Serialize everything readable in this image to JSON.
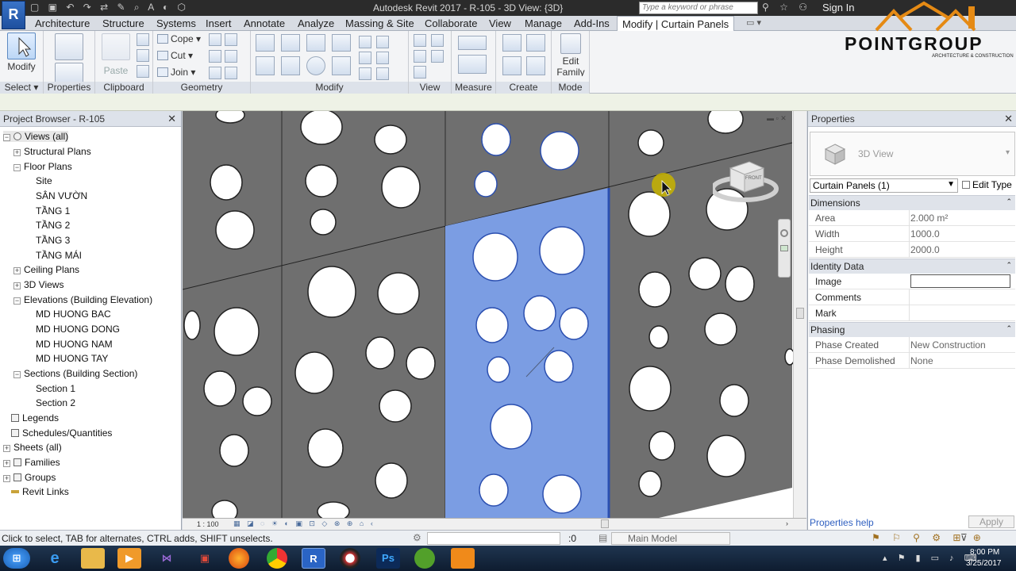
{
  "titlebar": {
    "app_title": "Autodesk Revit 2017  -   R-105 - 3D View: {3D}",
    "search_placeholder": "Type a keyword or phrase",
    "sign_in": "Sign In"
  },
  "tabs": [
    "Architecture",
    "Structure",
    "Systems",
    "Insert",
    "Annotate",
    "Analyze",
    "Massing & Site",
    "Collaborate",
    "View",
    "Manage",
    "Add-Ins",
    "Modify | Curtain Panels"
  ],
  "ribbon": {
    "modify_label": "Modify",
    "paste_label": "Paste",
    "cope_label": "Cope",
    "cut_label": "Cut",
    "join_label": "Join",
    "edit_family_label": "Edit Family",
    "panels": [
      "Select",
      "Properties",
      "Clipboard",
      "Geometry",
      "Modify",
      "View",
      "Measure",
      "Create",
      "Mode"
    ]
  },
  "logo": {
    "name": "POINTGROUP",
    "tagline": "ARCHITECTURE & CONSTRUCTION"
  },
  "project_browser": {
    "title": "Project Browser - R-105",
    "items": [
      {
        "label": "Views (all)"
      },
      {
        "label": "Structural Plans"
      },
      {
        "label": "Floor Plans"
      },
      {
        "label": "Site"
      },
      {
        "label": "SÂN VƯỜN"
      },
      {
        "label": "TẦNG 1"
      },
      {
        "label": "TẦNG 2"
      },
      {
        "label": "TẦNG 3"
      },
      {
        "label": "TẦNG MÁI"
      },
      {
        "label": "Ceiling Plans"
      },
      {
        "label": "3D Views"
      },
      {
        "label": "Elevations (Building Elevation)"
      },
      {
        "label": "MD HUONG BAC"
      },
      {
        "label": "MD HUONG DONG"
      },
      {
        "label": "MD HUONG NAM"
      },
      {
        "label": "MD HUONG TAY"
      },
      {
        "label": "Sections (Building Section)"
      },
      {
        "label": "Section 1"
      },
      {
        "label": "Section 2"
      },
      {
        "label": "Legends"
      },
      {
        "label": "Schedules/Quantities"
      },
      {
        "label": "Sheets (all)"
      },
      {
        "label": "Families"
      },
      {
        "label": "Groups"
      },
      {
        "label": "Revit Links"
      }
    ]
  },
  "viewport": {
    "scale": "1 : 100",
    "viewcube_face": "FRONT"
  },
  "properties": {
    "title": "Properties",
    "type_name": "3D View",
    "selector_value": "Curtain Panels (1)",
    "edit_type": "Edit Type",
    "groups": [
      {
        "name": "Dimensions",
        "rows": [
          {
            "key": "Area",
            "value": "2.000 m²"
          },
          {
            "key": "Width",
            "value": "1000.0"
          },
          {
            "key": "Height",
            "value": "2000.0"
          }
        ]
      },
      {
        "name": "Identity Data",
        "rows": [
          {
            "key": "Image",
            "value": ""
          },
          {
            "key": "Comments",
            "value": ""
          },
          {
            "key": "Mark",
            "value": ""
          }
        ]
      },
      {
        "name": "Phasing",
        "rows": [
          {
            "key": "Phase Created",
            "value": "New Construction"
          },
          {
            "key": "Phase Demolished",
            "value": "None"
          }
        ]
      }
    ],
    "help_link": "Properties help",
    "apply": "Apply"
  },
  "statusbar": {
    "message": "Click to select, TAB for alternates, CTRL adds, SHIFT unselects.",
    "selection_count": ":0",
    "model": "Main Model"
  },
  "taskbar": {
    "time": "8:00 PM",
    "date": "3/25/2017"
  },
  "colors": {
    "panel_gray": "#6f6f6f",
    "selected_blue": "#7b9de3",
    "accent_yellow": "#c8b400"
  }
}
